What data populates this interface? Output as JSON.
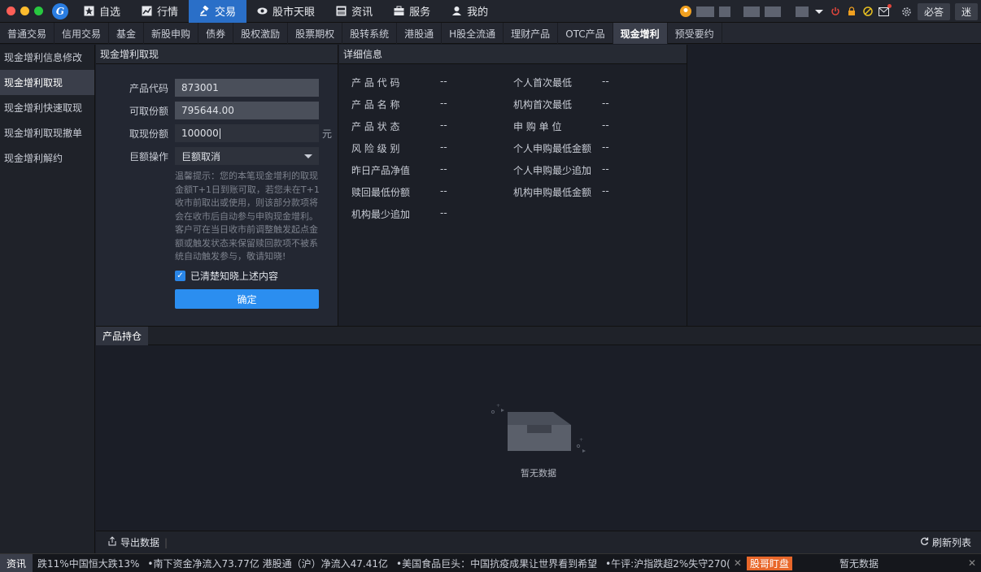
{
  "nav": {
    "items": [
      {
        "label": "自选",
        "icon": "star-icon"
      },
      {
        "label": "行情",
        "icon": "chart-icon"
      },
      {
        "label": "交易",
        "icon": "gavel-icon",
        "active": true
      },
      {
        "label": "股市天眼",
        "icon": "eye-icon"
      },
      {
        "label": "资讯",
        "icon": "news-icon"
      },
      {
        "label": "服务",
        "icon": "briefcase-icon"
      },
      {
        "label": "我的",
        "icon": "user-icon"
      }
    ],
    "right": {
      "ask_label": "必答",
      "mini_label": "迷"
    }
  },
  "tabs": [
    "普通交易",
    "信用交易",
    "基金",
    "新股申购",
    "债券",
    "股权激励",
    "股票期权",
    "股转系统",
    "港股通",
    "H股全流通",
    "理财产品",
    "OTC产品",
    "现金增利",
    "预受要约"
  ],
  "active_tab": "现金增利",
  "sidebar": {
    "items": [
      "现金增利信息修改",
      "现金增利取现",
      "现金增利快速取现",
      "现金增利取现撤单",
      "现金增利解约"
    ],
    "active": "现金增利取现"
  },
  "form": {
    "title": "现金增利取现",
    "product_code_label": "产品代码",
    "product_code_value": "873001",
    "available_label": "可取份额",
    "available_value": "795644.00",
    "withdraw_label": "取现份额",
    "withdraw_value": "100000",
    "unit": "元",
    "large_op_label": "巨额操作",
    "large_op_value": "巨额取消",
    "hint": "温馨提示：您的本笔现金增利的取现金额T+1日到账可取，若您未在T+1收市前取出或使用，则该部分款项将会在收市后自动参与申购现金增利。客户可在当日收市前调整触发起点金额或触发状态来保留赎回款项不被系统自动触发参与，敬请知晓!",
    "checkbox_label": "已清楚知晓上述内容",
    "confirm_label": "确定"
  },
  "detail": {
    "title": "详细信息",
    "left": [
      {
        "label": "产 品 代 码",
        "value": "--"
      },
      {
        "label": "产 品 名 称",
        "value": "--"
      },
      {
        "label": "产 品 状 态",
        "value": "--"
      },
      {
        "label": "风 险 级 别",
        "value": "--"
      },
      {
        "label": "昨日产品净值",
        "value": "--"
      },
      {
        "label": "赎回最低份额",
        "value": "--"
      },
      {
        "label": "机构最少追加",
        "value": "--"
      }
    ],
    "right": [
      {
        "label": "个人首次最低",
        "value": "--"
      },
      {
        "label": "机构首次最低",
        "value": "--"
      },
      {
        "label": "申 购 单 位",
        "value": "--"
      },
      {
        "label": "个人申购最低金额",
        "value": "--"
      },
      {
        "label": "个人申购最少追加",
        "value": "--"
      },
      {
        "label": "机构申购最低金额",
        "value": "--"
      }
    ]
  },
  "holdings": {
    "tab_label": "产品持仓",
    "empty_text": "暂无数据",
    "export_label": "导出数据",
    "refresh_label": "刷新列表"
  },
  "ticker": {
    "label": "资讯",
    "items": [
      "跌11%中国恒大跌13%",
      "•南下资金净流入73.77亿 港股通（沪）净流入47.41亿",
      "•美国食品巨头：中国抗疫成果让世界看到希望",
      "•午评:沪指跌超2%失守270("
    ],
    "badge": "股哥盯盘",
    "right_text": "暂无数据"
  },
  "colors": {
    "active_nav": "#2a6fc8",
    "confirm_button": "#2b8ef0",
    "ticker_badge": "#e8672a"
  }
}
